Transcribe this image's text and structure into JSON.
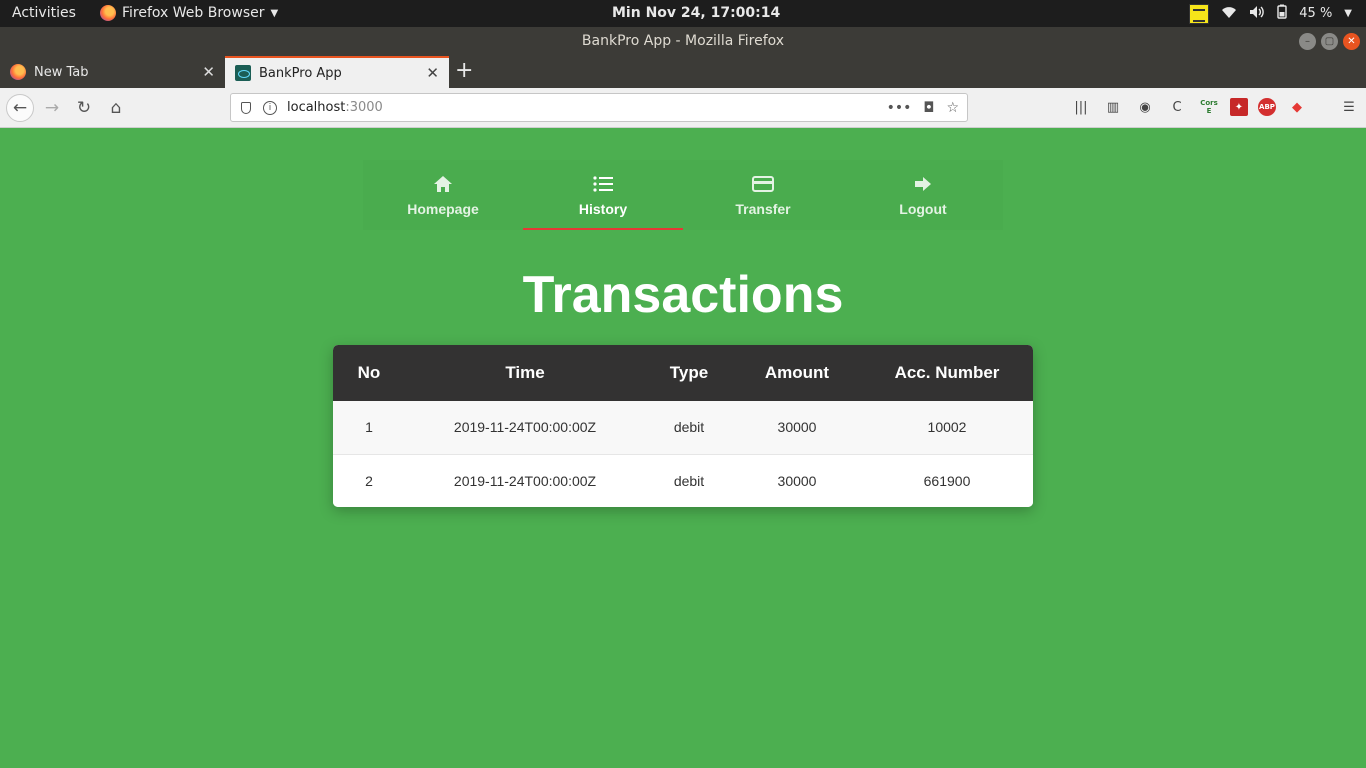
{
  "topbar": {
    "activities": "Activities",
    "app_name": "Firefox Web Browser",
    "clock": "Min Nov 24, 17:00:14",
    "battery": "45 %"
  },
  "window": {
    "title": "BankPro App - Mozilla Firefox"
  },
  "tabs": [
    {
      "title": "New Tab",
      "active": false
    },
    {
      "title": "BankPro App",
      "active": true
    }
  ],
  "url": {
    "host": "localhost",
    "port": ":3000"
  },
  "app": {
    "nav": [
      {
        "label": "Homepage",
        "icon": "home-icon"
      },
      {
        "label": "History",
        "icon": "list-icon",
        "selected": true
      },
      {
        "label": "Transfer",
        "icon": "credit-card-icon"
      },
      {
        "label": "Logout",
        "icon": "arrow-right-icon"
      }
    ],
    "heading": "Transactions",
    "table": {
      "headers": [
        "No",
        "Time",
        "Type",
        "Amount",
        "Acc. Number"
      ],
      "rows": [
        [
          "1",
          "2019-11-24T00:00:00Z",
          "debit",
          "30000",
          "10002"
        ],
        [
          "2",
          "2019-11-24T00:00:00Z",
          "debit",
          "30000",
          "661900"
        ]
      ]
    }
  },
  "colors": {
    "background": "#4caf50",
    "table_header": "#333232",
    "active_underline": "#e53935",
    "tab_accent": "#e95420"
  }
}
